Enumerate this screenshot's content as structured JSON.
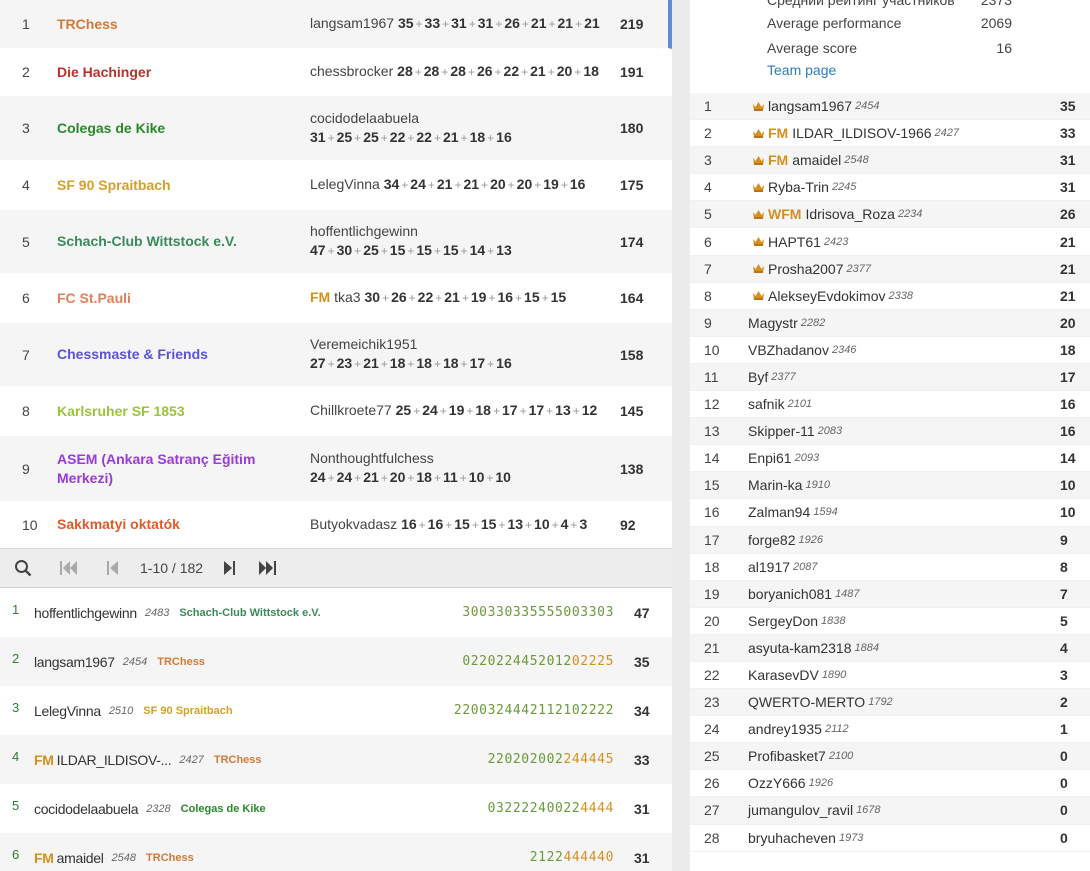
{
  "teams": [
    {
      "rank": "1",
      "name": "TRChess",
      "color": "#d17a3a",
      "pre": "",
      "title": "",
      "lead": "langsam1967",
      "scores": [
        "35",
        "33",
        "31",
        "31",
        "26",
        "21",
        "21",
        "21"
      ],
      "total": "219"
    },
    {
      "rank": "2",
      "name": "Die Hachinger",
      "color": "#b8322c",
      "pre": "",
      "title": "",
      "lead": "chessbrocker",
      "scores": [
        "28",
        "28",
        "28",
        "26",
        "22",
        "21",
        "20",
        "18"
      ],
      "total": "191"
    },
    {
      "rank": "3",
      "name": "Colegas de Kike",
      "color": "#2a8a2a",
      "pre": "",
      "title": "",
      "lead": "cocidodelaabuela",
      "scores": [
        "31",
        "25",
        "25",
        "22",
        "22",
        "21",
        "18",
        "16"
      ],
      "total": "180"
    },
    {
      "rank": "4",
      "name": "SF 90 Spraitbach",
      "color": "#d4a02c",
      "pre": "",
      "title": "",
      "lead": "LelegVinna",
      "scores": [
        "34",
        "24",
        "21",
        "21",
        "20",
        "20",
        "19",
        "16"
      ],
      "total": "175"
    },
    {
      "rank": "5",
      "name": "Schach-Club Wittstock e.V.",
      "color": "#3a8a5a",
      "pre": "",
      "title": "",
      "lead": "hoffentlichgewinn",
      "scores": [
        "47",
        "30",
        "25",
        "15",
        "15",
        "15",
        "14",
        "13"
      ],
      "total": "174"
    },
    {
      "rank": "6",
      "name": "FC St.Pauli",
      "color": "#e0805a",
      "pre": "",
      "title": "FM",
      "lead": "tka3",
      "scores": [
        "30",
        "26",
        "22",
        "21",
        "19",
        "16",
        "15",
        "15"
      ],
      "total": "164"
    },
    {
      "rank": "7",
      "name": "Chessmaste & Friends",
      "color": "#5a55d8",
      "pre": "",
      "title": "",
      "lead": "Veremeichik1951",
      "scores": [
        "27",
        "23",
        "21",
        "18",
        "18",
        "18",
        "17",
        "16"
      ],
      "total": "158"
    },
    {
      "rank": "8",
      "name": "Karlsruher SF 1853",
      "color": "#9ac43a",
      "pre": "",
      "title": "",
      "lead": "Chillkroete77",
      "scores": [
        "25",
        "24",
        "19",
        "18",
        "17",
        "17",
        "13",
        "12"
      ],
      "total": "145"
    },
    {
      "rank": "9",
      "name": "ASEM (Ankara Satranç Eğitim Merkezi)",
      "color": "#9a3ad8",
      "pre": "",
      "title": "",
      "lead": "Nonthoughtfulchess",
      "scores": [
        "24",
        "24",
        "21",
        "20",
        "18",
        "11",
        "10",
        "10"
      ],
      "total": "138"
    },
    {
      "rank": "10",
      "name": "Sakkmatyi oktatók",
      "color": "#e05a2a",
      "pre": "",
      "title": "",
      "lead": "Butyokvadasz",
      "scores": [
        "16",
        "16",
        "15",
        "15",
        "13",
        "10",
        "4",
        "3"
      ],
      "total": "92"
    }
  ],
  "pager": {
    "range": "1-10 / 182"
  },
  "players": [
    {
      "rank": "1",
      "title": "",
      "name": "hoffentlichgewinn",
      "rating": "2483",
      "team": "Schach-Club Wittstock e.V.",
      "team_color": "#3a8a5a",
      "scores": "300330335555003303",
      "hot_from": 18,
      "total": "47"
    },
    {
      "rank": "2",
      "title": "",
      "name": "langsam1967",
      "rating": "2454",
      "team": "TRChess",
      "team_color": "#d17a3a",
      "scores": "022022445201202225",
      "hot_from": 13,
      "total": "35"
    },
    {
      "rank": "3",
      "title": "",
      "name": "LelegVinna",
      "rating": "2510",
      "team": "SF 90 Spraitbach",
      "team_color": "#d4a02c",
      "scores": "2200324442112102222",
      "hot_from": 19,
      "total": "34"
    },
    {
      "rank": "4",
      "title": "FM",
      "name": "ILDAR_ILDISOV-...",
      "rating": "2427",
      "team": "TRChess",
      "team_color": "#d17a3a",
      "scores": "220202002244445",
      "hot_from": 9,
      "total": "33"
    },
    {
      "rank": "5",
      "title": "",
      "name": "cocidodelaabuela",
      "rating": "2328",
      "team": "Colegas de Kike",
      "team_color": "#2a8a2a",
      "scores": "032222400224444",
      "hot_from": 11,
      "total": "31"
    },
    {
      "rank": "6",
      "title": "FM",
      "name": "amaidel",
      "rating": "2548",
      "team": "TRChess",
      "team_color": "#d17a3a",
      "scores": "2122444440",
      "hot_from": 4,
      "total": "31"
    }
  ],
  "info": {
    "top_label": "Средний рейтинг участников",
    "top_value": "2373",
    "perf_label": "Average performance",
    "perf_value": "2069",
    "score_label": "Average score",
    "score_value": "16",
    "team_page": "Team page"
  },
  "team_players": [
    {
      "rank": "1",
      "crown": true,
      "title": "",
      "name": "langsam1967",
      "rating": "2454",
      "score": "35"
    },
    {
      "rank": "2",
      "crown": true,
      "title": "FM",
      "name": "ILDAR_ILDISOV-1966",
      "rating": "2427",
      "score": "33"
    },
    {
      "rank": "3",
      "crown": true,
      "title": "FM",
      "name": "amaidel",
      "rating": "2548",
      "score": "31"
    },
    {
      "rank": "4",
      "crown": true,
      "title": "",
      "name": "Ryba-Trin",
      "rating": "2245",
      "score": "31"
    },
    {
      "rank": "5",
      "crown": true,
      "title": "WFM",
      "name": "Idrisova_Roza",
      "rating": "2234",
      "score": "26"
    },
    {
      "rank": "6",
      "crown": true,
      "title": "",
      "name": "HAPT61",
      "rating": "2423",
      "score": "21"
    },
    {
      "rank": "7",
      "crown": true,
      "title": "",
      "name": "Prosha2007",
      "rating": "2377",
      "score": "21"
    },
    {
      "rank": "8",
      "crown": true,
      "title": "",
      "name": "AlekseyEvdokimov",
      "rating": "2338",
      "score": "21"
    },
    {
      "rank": "9",
      "crown": false,
      "title": "",
      "name": "Magystr",
      "rating": "2282",
      "score": "20"
    },
    {
      "rank": "10",
      "crown": false,
      "title": "",
      "name": "VBZhadanov",
      "rating": "2346",
      "score": "18"
    },
    {
      "rank": "11",
      "crown": false,
      "title": "",
      "name": "Byf",
      "rating": "2377",
      "score": "17"
    },
    {
      "rank": "12",
      "crown": false,
      "title": "",
      "name": "safnik",
      "rating": "2101",
      "score": "16"
    },
    {
      "rank": "13",
      "crown": false,
      "title": "",
      "name": "Skipper-11",
      "rating": "2083",
      "score": "16"
    },
    {
      "rank": "14",
      "crown": false,
      "title": "",
      "name": "Enpi61",
      "rating": "2093",
      "score": "14"
    },
    {
      "rank": "15",
      "crown": false,
      "title": "",
      "name": "Marin-ka",
      "rating": "1910",
      "score": "10"
    },
    {
      "rank": "16",
      "crown": false,
      "title": "",
      "name": "Zalman94",
      "rating": "1594",
      "score": "10"
    },
    {
      "rank": "17",
      "crown": false,
      "title": "",
      "name": "forge82",
      "rating": "1926",
      "score": "9"
    },
    {
      "rank": "18",
      "crown": false,
      "title": "",
      "name": "al1917",
      "rating": "2087",
      "score": "8"
    },
    {
      "rank": "19",
      "crown": false,
      "title": "",
      "name": "boryanich081",
      "rating": "1487",
      "score": "7"
    },
    {
      "rank": "20",
      "crown": false,
      "title": "",
      "name": "SergeyDon",
      "rating": "1838",
      "score": "5"
    },
    {
      "rank": "21",
      "crown": false,
      "title": "",
      "name": "asyuta-kam2318",
      "rating": "1884",
      "score": "4"
    },
    {
      "rank": "22",
      "crown": false,
      "title": "",
      "name": "KarasevDV",
      "rating": "1890",
      "score": "3"
    },
    {
      "rank": "23",
      "crown": false,
      "title": "",
      "name": "QWERTO-MERTO",
      "rating": "1792",
      "score": "2"
    },
    {
      "rank": "24",
      "crown": false,
      "title": "",
      "name": "andrey1935",
      "rating": "2112",
      "score": "1"
    },
    {
      "rank": "25",
      "crown": false,
      "title": "",
      "name": "Profibasket7",
      "rating": "2100",
      "score": "0"
    },
    {
      "rank": "26",
      "crown": false,
      "title": "",
      "name": "OzzY666",
      "rating": "1926",
      "score": "0"
    },
    {
      "rank": "27",
      "crown": false,
      "title": "",
      "name": "jumangulov_ravil",
      "rating": "1678",
      "score": "0"
    },
    {
      "rank": "28",
      "crown": false,
      "title": "",
      "name": "bryuhacheven",
      "rating": "1973",
      "score": "0"
    }
  ],
  "icons": {
    "search": "search-icon",
    "first": "first-page-icon",
    "prev": "prev-page-icon",
    "next": "next-page-icon",
    "last": "last-page-icon",
    "crown": "crown-icon"
  },
  "colors": {
    "accent": "#2b7dc0",
    "gold": "#d59020",
    "score_green": "#6a9a3a"
  }
}
